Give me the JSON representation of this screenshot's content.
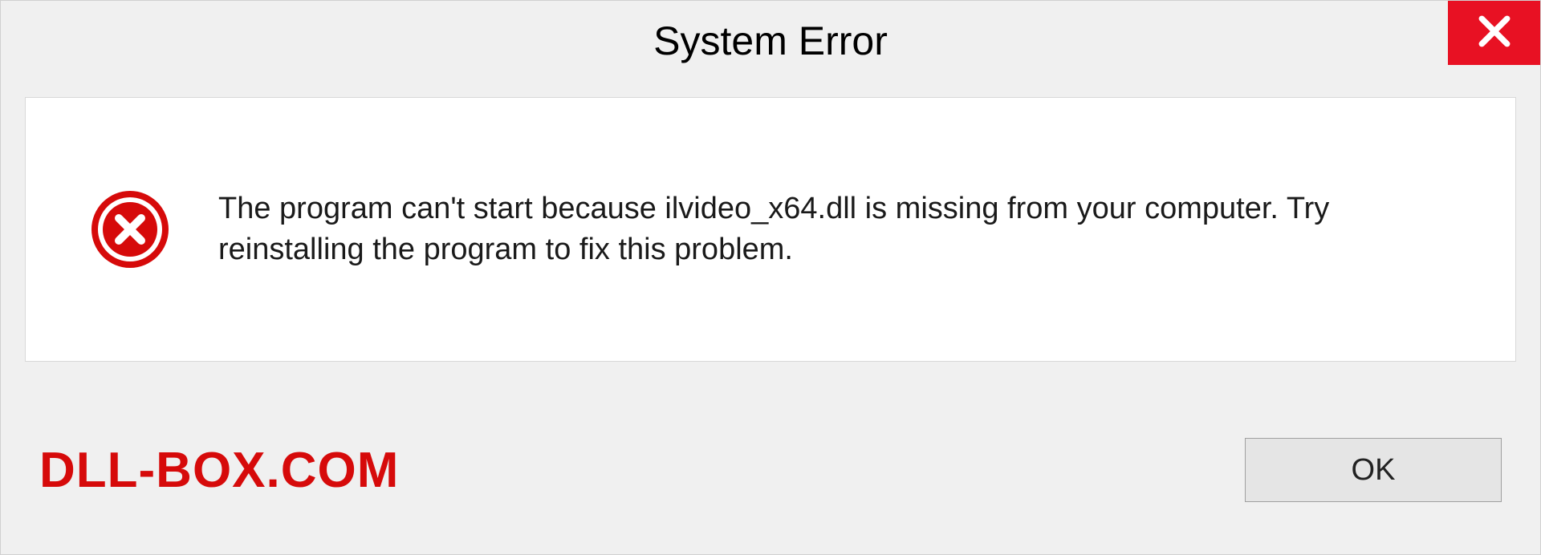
{
  "titlebar": {
    "title": "System Error"
  },
  "content": {
    "message": "The program can't start because ilvideo_x64.dll is missing from your computer. Try reinstalling the program to fix this problem."
  },
  "footer": {
    "branding": "DLL-BOX.COM",
    "ok_label": "OK"
  },
  "colors": {
    "close_bg": "#e81123",
    "error_icon": "#d60a0a",
    "branding": "#d60a0a"
  }
}
